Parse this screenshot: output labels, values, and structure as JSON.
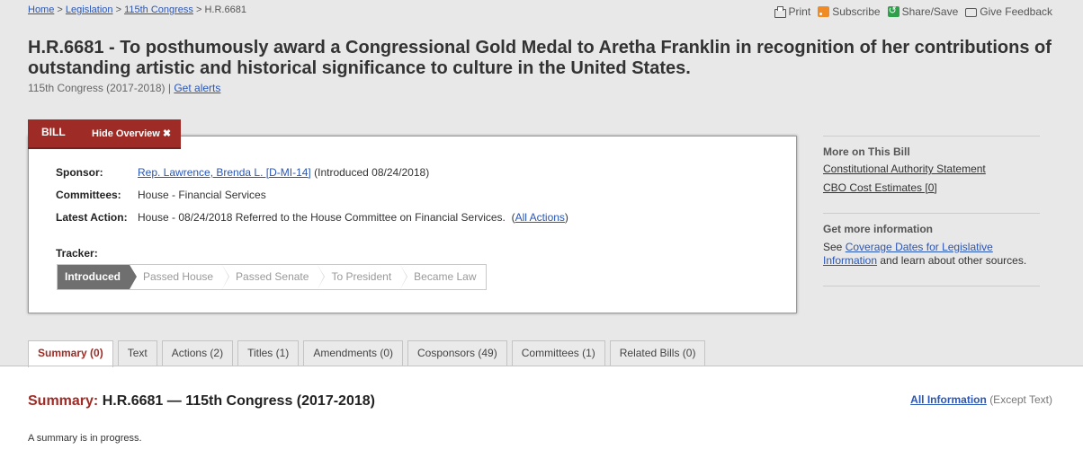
{
  "breadcrumb": {
    "home": "Home",
    "sep1": ">",
    "legislation": "Legislation",
    "sep2": ">",
    "congress": "115th Congress",
    "sep3": ">",
    "current": "H.R.6681"
  },
  "tools": {
    "print": "Print",
    "subscribe": "Subscribe",
    "share": "Share/Save",
    "feedback": "Give Feedback"
  },
  "title": "H.R.6681 - To posthumously award a Congressional Gold Medal to Aretha Franklin in recognition of her contributions of outstanding artistic and historical significance to culture in the United States.",
  "subtitle": {
    "congress": "115th Congress (2017-2018) |",
    "alerts": "Get alerts"
  },
  "billtab": {
    "label": "BILL",
    "hide": "Hide Overview ✖"
  },
  "overview": {
    "sponsor_label": "Sponsor:",
    "sponsor_name": "Rep. Lawrence, Brenda L. [D-MI-14]",
    "sponsor_intro": "(Introduced 08/24/2018)",
    "committees_label": "Committees:",
    "committees_value": "House - Financial Services",
    "action_label": "Latest Action:",
    "action_value": "House - 08/24/2018 Referred to the House Committee on Financial Services.",
    "action_open": "(",
    "action_link": "All Actions",
    "action_close": ")",
    "tracker_label": "Tracker:",
    "tracker_steps": [
      "Introduced",
      "Passed House",
      "Passed Senate",
      "To President",
      "Became Law"
    ]
  },
  "sidebar": {
    "more_heading": "More on This Bill",
    "link1": "Constitutional Authority Statement",
    "link2": "CBO Cost Estimates [0]",
    "info_heading": "Get more information",
    "see": "See",
    "coverage_link": "Coverage Dates for Legislative Information",
    "learn": "and learn about other sources."
  },
  "tabs": [
    "Summary (0)",
    "Text",
    "Actions (2)",
    "Titles (1)",
    "Amendments (0)",
    "Cosponsors (49)",
    "Committees (1)",
    "Related Bills (0)"
  ],
  "summary": {
    "label": "Summary:",
    "heading": "H.R.6681 — 115th Congress (2017-2018)",
    "all_info": "All Information",
    "except": "(Except Text)",
    "note": "A summary is in progress."
  },
  "colors": {
    "accent": "#9e2b25",
    "link": "#2a56b6",
    "band": "#e8e8e8"
  }
}
